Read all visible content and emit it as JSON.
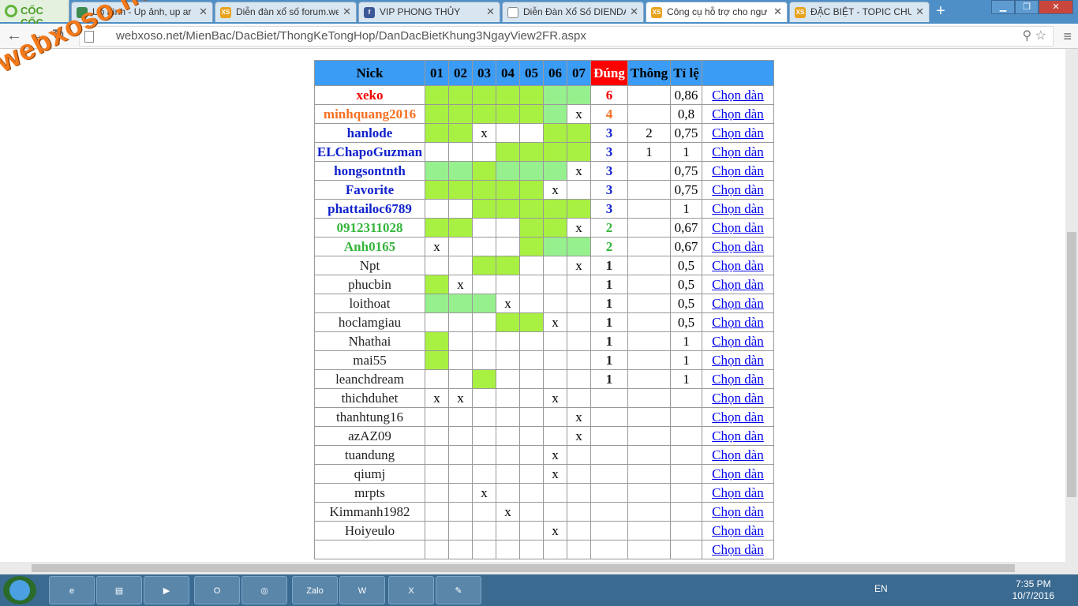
{
  "browser": {
    "brand": "CỐC CỐC",
    "tabs": [
      {
        "title": "Up hình - Up ảnh, up ar"
      },
      {
        "title": "Diễn đàn xổ số forum.we"
      },
      {
        "title": "VIP PHONG THỦY"
      },
      {
        "title": "Diễn Đàn Xổ Số DIENDA"
      },
      {
        "title": "Công cụ hỗ trợ cho ngư"
      },
      {
        "title": "ĐẶC BIỆT - TOPIC CHUY"
      }
    ],
    "url": "webxoso.net/MienBac/DacBiet/ThongKeTongHop/DanDacBietKhung3NgayView2FR.aspx"
  },
  "watermark": "webxoso.net",
  "table": {
    "headers": [
      "Nick",
      "01",
      "02",
      "03",
      "04",
      "05",
      "06",
      "07",
      "Đúng",
      "Thông",
      "Tỉ lệ"
    ],
    "link_label": "Chọn dàn",
    "rows": [
      {
        "nick": "xeko",
        "d": [
          "g1",
          "g1",
          "g1",
          "g1",
          "g1",
          "g2",
          "g2"
        ],
        "dung": "6",
        "thong": "",
        "tl": "0,86",
        "c": "r"
      },
      {
        "nick": "minhquang2016",
        "d": [
          "g1",
          "g1",
          "g1",
          "g1",
          "g1",
          "g2",
          "x"
        ],
        "dung": "4",
        "thong": "",
        "tl": "0,8",
        "c": "o"
      },
      {
        "nick": "hanlode",
        "d": [
          "g1",
          "g1",
          "x",
          "",
          "",
          "g1",
          "g1"
        ],
        "dung": "3",
        "thong": "2",
        "tl": "0,75",
        "c": "b"
      },
      {
        "nick": "ELChapoGuzman",
        "d": [
          "",
          "",
          "",
          "g1",
          "g1",
          "g1",
          "g1"
        ],
        "dung": "3",
        "thong": "1",
        "tl": "1",
        "c": "b"
      },
      {
        "nick": "hongsontnth",
        "d": [
          "g2",
          "g2",
          "g1",
          "g2",
          "g2",
          "g2",
          "x"
        ],
        "dung": "3",
        "thong": "",
        "tl": "0,75",
        "c": "b"
      },
      {
        "nick": "Favorite",
        "d": [
          "g1",
          "g1",
          "g1",
          "g1",
          "g1",
          "x",
          ""
        ],
        "dung": "3",
        "thong": "",
        "tl": "0,75",
        "c": "b"
      },
      {
        "nick": "phattailoc6789",
        "d": [
          "",
          "",
          "g1",
          "g1",
          "g1",
          "g1",
          "g1"
        ],
        "dung": "3",
        "thong": "",
        "tl": "1",
        "c": "b"
      },
      {
        "nick": "0912311028",
        "d": [
          "g1",
          "g1",
          "",
          "",
          "g1",
          "g1",
          "x"
        ],
        "dung": "2",
        "thong": "",
        "tl": "0,67",
        "c": "gr"
      },
      {
        "nick": "Anh0165",
        "d": [
          "x",
          "",
          "",
          "",
          "g1",
          "g2",
          "g2"
        ],
        "dung": "2",
        "thong": "",
        "tl": "0,67",
        "c": "gr"
      },
      {
        "nick": "Npt",
        "d": [
          "",
          "",
          "g1",
          "g1",
          "",
          "",
          "x"
        ],
        "dung": "1",
        "thong": "",
        "tl": "0,5",
        "c": "k"
      },
      {
        "nick": "phucbin",
        "d": [
          "g1",
          "x",
          "",
          "",
          "",
          "",
          ""
        ],
        "dung": "1",
        "thong": "",
        "tl": "0,5",
        "c": "k"
      },
      {
        "nick": "loithoat",
        "d": [
          "g2",
          "g2",
          "g2",
          "x",
          "",
          "",
          ""
        ],
        "dung": "1",
        "thong": "",
        "tl": "0,5",
        "c": "k"
      },
      {
        "nick": "hoclamgiau",
        "d": [
          "",
          "",
          "",
          "g1",
          "g1",
          "x",
          ""
        ],
        "dung": "1",
        "thong": "",
        "tl": "0,5",
        "c": "k"
      },
      {
        "nick": "Nhathai",
        "d": [
          "g1",
          "",
          "",
          "",
          "",
          "",
          ""
        ],
        "dung": "1",
        "thong": "",
        "tl": "1",
        "c": "k"
      },
      {
        "nick": "mai55",
        "d": [
          "g1",
          "",
          "",
          "",
          "",
          "",
          ""
        ],
        "dung": "1",
        "thong": "",
        "tl": "1",
        "c": "k"
      },
      {
        "nick": "leanchdream",
        "d": [
          "",
          "",
          "g1",
          "",
          "",
          "",
          ""
        ],
        "dung": "1",
        "thong": "",
        "tl": "1",
        "c": "k"
      },
      {
        "nick": "thichduhet",
        "d": [
          "x",
          "x",
          "",
          "",
          "",
          "x",
          ""
        ],
        "dung": "",
        "thong": "",
        "tl": "",
        "c": "k"
      },
      {
        "nick": "thanhtung16",
        "d": [
          "",
          "",
          "",
          "",
          "",
          "",
          "x"
        ],
        "dung": "",
        "thong": "",
        "tl": "",
        "c": "k"
      },
      {
        "nick": "azAZ09",
        "d": [
          "",
          "",
          "",
          "",
          "",
          "",
          "x"
        ],
        "dung": "",
        "thong": "",
        "tl": "",
        "c": "k"
      },
      {
        "nick": "tuandung",
        "d": [
          "",
          "",
          "",
          "",
          "",
          "x",
          ""
        ],
        "dung": "",
        "thong": "",
        "tl": "",
        "c": "k"
      },
      {
        "nick": "qiumj",
        "d": [
          "",
          "",
          "",
          "",
          "",
          "x",
          ""
        ],
        "dung": "",
        "thong": "",
        "tl": "",
        "c": "k"
      },
      {
        "nick": "mrpts",
        "d": [
          "",
          "",
          "x",
          "",
          "",
          "",
          ""
        ],
        "dung": "",
        "thong": "",
        "tl": "",
        "c": "k"
      },
      {
        "nick": "Kimmanh1982",
        "d": [
          "",
          "",
          "",
          "x",
          "",
          "",
          ""
        ],
        "dung": "",
        "thong": "",
        "tl": "",
        "c": "k"
      },
      {
        "nick": "Hoiyeulo",
        "d": [
          "",
          "",
          "",
          "",
          "",
          "x",
          ""
        ],
        "dung": "",
        "thong": "",
        "tl": "",
        "c": "k"
      },
      {
        "nick": "",
        "d": [
          "",
          "",
          "",
          "",
          "",
          "",
          ""
        ],
        "dung": "",
        "thong": "",
        "tl": "",
        "c": "k"
      }
    ]
  },
  "taskbar": {
    "lang": "EN",
    "time": "7:35 PM",
    "date": "10/7/2016",
    "zalo": "Zalo"
  },
  "colors": {
    "header": "#3b9cf5",
    "dung_header": "#ff0000",
    "green1": "#a8f041",
    "green2": "#96f08d"
  }
}
